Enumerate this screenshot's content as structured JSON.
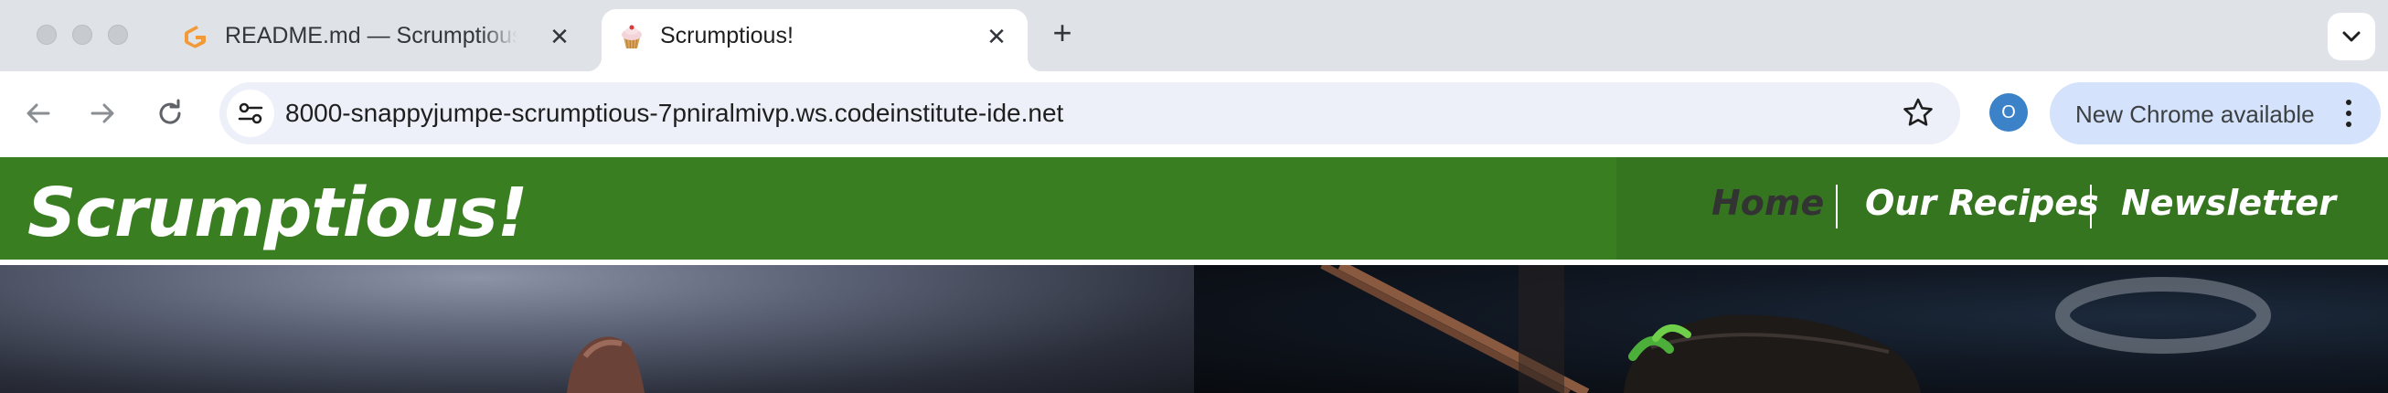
{
  "browser": {
    "tabs": [
      {
        "title": "README.md — Scrumptious - Gitpod",
        "favicon": "gitpod-icon",
        "active": false
      },
      {
        "title": "Scrumptious!",
        "favicon": "cupcake-icon",
        "active": true
      }
    ],
    "address_bar": {
      "url": "8000-snappyjumpe-scrumptious-7pniralmivp.ws.codeinstitute-ide.net"
    },
    "profile_initial": "O",
    "update_label": "New Chrome available",
    "colors": {
      "profile": "#3b82c8",
      "update_bg": "#d4e2fb"
    }
  },
  "site": {
    "brand": "Scrumptious!",
    "nav": [
      {
        "label": "Home",
        "active": true
      },
      {
        "label": "Our Recipes",
        "active": false
      },
      {
        "label": "Newsletter",
        "active": false
      }
    ],
    "colors": {
      "header": "#3a7e22",
      "nav_active": "#333333",
      "nav_text": "#ffffff"
    }
  }
}
